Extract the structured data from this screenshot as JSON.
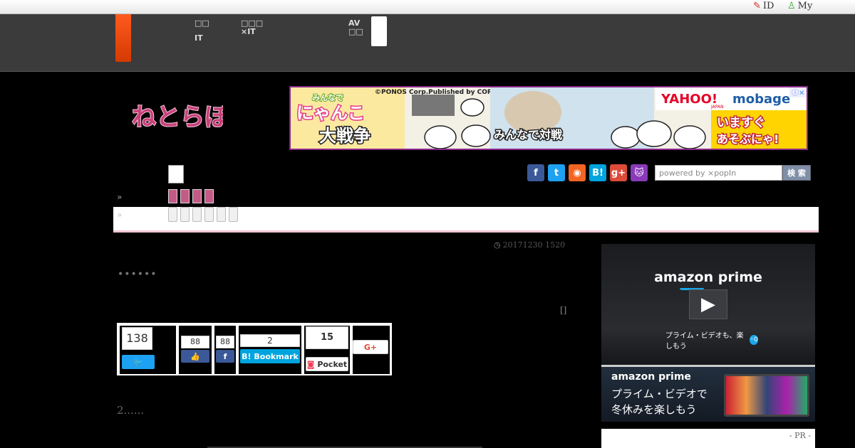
{
  "topbar": {
    "id_link": "ID",
    "my_link": "My"
  },
  "gnav": {
    "item1_line1": "□□",
    "item1_line2": "IT",
    "item2_line1": "□□□",
    "item2_line2": "×IT",
    "item3_line1": "AV",
    "item3_line2": "□□"
  },
  "logo": {
    "text": "ねとらぼ",
    "color": "#c8407a"
  },
  "ad": {
    "game_title_line1": "みんなで",
    "game_title_line2": "にゃんこ",
    "game_title_line3": "大戦争",
    "copyright": "©PONOS Corp.Published by CORE EDGE.",
    "battle_text": "みんなで対戦",
    "yahoo": "YAHOO!",
    "japan": "JAPAN",
    "mobage": "mobage",
    "cta_line1": "いますぐ",
    "cta_line2": "あそぶにゃ!"
  },
  "search": {
    "placeholder": "powered by ×popIn",
    "button": "検 索"
  },
  "breadcrumbs": {
    "row1": "»",
    "row2": "»"
  },
  "article": {
    "date": "20171230 1520",
    "intro": "••••••",
    "bracket": "[]",
    "section2": "2......"
  },
  "share": {
    "twitter_count": "138",
    "like_count": "88",
    "fb_count": "88",
    "hatena_count": "2",
    "hatena_label": "B! Bookmark",
    "pocket_count": "15",
    "pocket_label": "Pocket",
    "gplus_label": "G+"
  },
  "sidebar": {
    "amz1_brand": "amazon prime",
    "amz1_tagline": "プライム・ビデオも、楽しもう",
    "amz2_brand": "amazon prime",
    "amz2_line1": "プライム・ビデオで",
    "amz2_line2": "冬休みを楽しもう",
    "pr": "- PR -"
  },
  "colors": {
    "accent": "#c8407a",
    "gnav_bg": "#3b3b3b",
    "twitter": "#1da1f2",
    "facebook": "#3b5998",
    "hatena": "#00a4de",
    "pocket": "#ef4056",
    "gplus": "#dd4b39"
  }
}
